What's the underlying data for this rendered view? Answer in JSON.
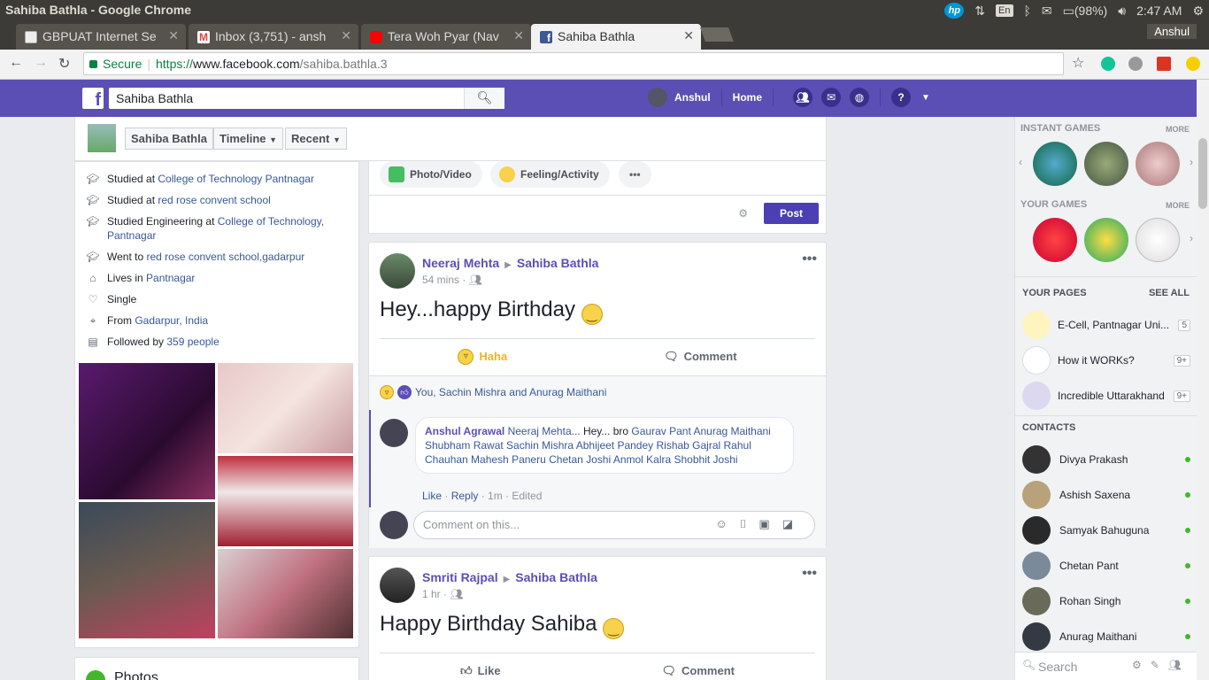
{
  "os": {
    "window_title": "Sahiba Bathla - Google Chrome",
    "keyboard": "En",
    "battery": "(98%)",
    "time": "2:47 AM",
    "hp": "hp"
  },
  "tabs": [
    {
      "title": "GBPUAT Internet Se"
    },
    {
      "title": "Inbox (3,751) - ansh"
    },
    {
      "title": "Tera Woh Pyar (Nav"
    },
    {
      "title": "Sahiba Bathla"
    }
  ],
  "chrome_user": "Anshul",
  "address": {
    "secure_label": "Secure",
    "scheme": "https://",
    "host": "www.facebook.com",
    "path": "/sahiba.bathla.3"
  },
  "fb": {
    "search_value": "Sahiba Bathla",
    "user_name": "Anshul",
    "home_label": "Home"
  },
  "profile_nav": {
    "name": "Sahiba Bathla",
    "timeline": "Timeline",
    "recent": "Recent"
  },
  "intro": [
    {
      "prefix": "Studied at ",
      "link": "College of Technology Pantnagar",
      "icon": "graduation-cap-icon"
    },
    {
      "prefix": "Studied at ",
      "link": "red rose convent school",
      "icon": "graduation-cap-icon"
    },
    {
      "prefix": "Studied Engineering at ",
      "link": "College of Technology, Pantnagar",
      "icon": "graduation-cap-icon"
    },
    {
      "prefix": "Went to ",
      "link": "red rose convent school,gadarpur",
      "icon": "graduation-cap-icon"
    },
    {
      "prefix": "Lives in ",
      "link": "Pantnagar",
      "icon": "home-icon"
    },
    {
      "prefix": "Single",
      "link": "",
      "icon": "heart-icon"
    },
    {
      "prefix": "From ",
      "link": "Gadarpur, India",
      "icon": "location-pin-icon"
    },
    {
      "prefix": "Followed by ",
      "link": "359 people",
      "icon": "followers-icon"
    }
  ],
  "photos_card_title": "Photos",
  "composer": {
    "photo_video": "Photo/Video",
    "feeling": "Feeling/Activity",
    "more": "•••",
    "post": "Post"
  },
  "post1": {
    "author": "Neeraj Mehta",
    "target": "Sahiba Bathla",
    "time": "54 mins ·",
    "text": "Hey...happy Birthday",
    "reaction_label": "Haha",
    "comment_label": "Comment",
    "reactions_summary": "You, Sachin Mishra and Anurag Maithani",
    "comment": {
      "author": "Anshul Agrawal",
      "mention": "Neeraj Mehta...",
      "body": " Hey... bro ",
      "tags": "Gaurav Pant Anurag Maithani Shubham Rawat Sachin Mishra Abhijeet Pandey Rishab Gajral Rahul Chauhan Mahesh Paneru Chetan Joshi Anmol Kalra Shobhit Joshi",
      "like": "Like",
      "reply": "Reply",
      "meta": "· 1m · Edited"
    },
    "comment_placeholder": "Comment on this..."
  },
  "post2": {
    "author": "Smriti Rajpal",
    "target": "Sahiba Bathla",
    "time": "1 hr ·",
    "text": "Happy Birthday Sahiba",
    "like_label": "Like",
    "comment_label": "Comment"
  },
  "sidebar": {
    "instant_games": "INSTANT GAMES",
    "your_games": "YOUR GAMES",
    "more": "MORE",
    "your_pages": "YOUR PAGES",
    "see_all": "SEE ALL",
    "pages": [
      {
        "name": "E-Cell, Pantnagar Uni...",
        "count": "5"
      },
      {
        "name": "How it WORKs?",
        "count": "9+"
      },
      {
        "name": "Incredible Uttarakhand",
        "count": "9+"
      }
    ],
    "contacts_title": "CONTACTS",
    "contacts": [
      "Divya Prakash",
      "Ashish Saxena",
      "Samyak Bahuguna",
      "Chetan Pant",
      "Rohan Singh",
      "Anurag Maithani"
    ],
    "search_placeholder": "Search"
  },
  "colors": {
    "fb_brand": "#5b4fb5",
    "online": "#42b72a",
    "link": "#385898"
  }
}
